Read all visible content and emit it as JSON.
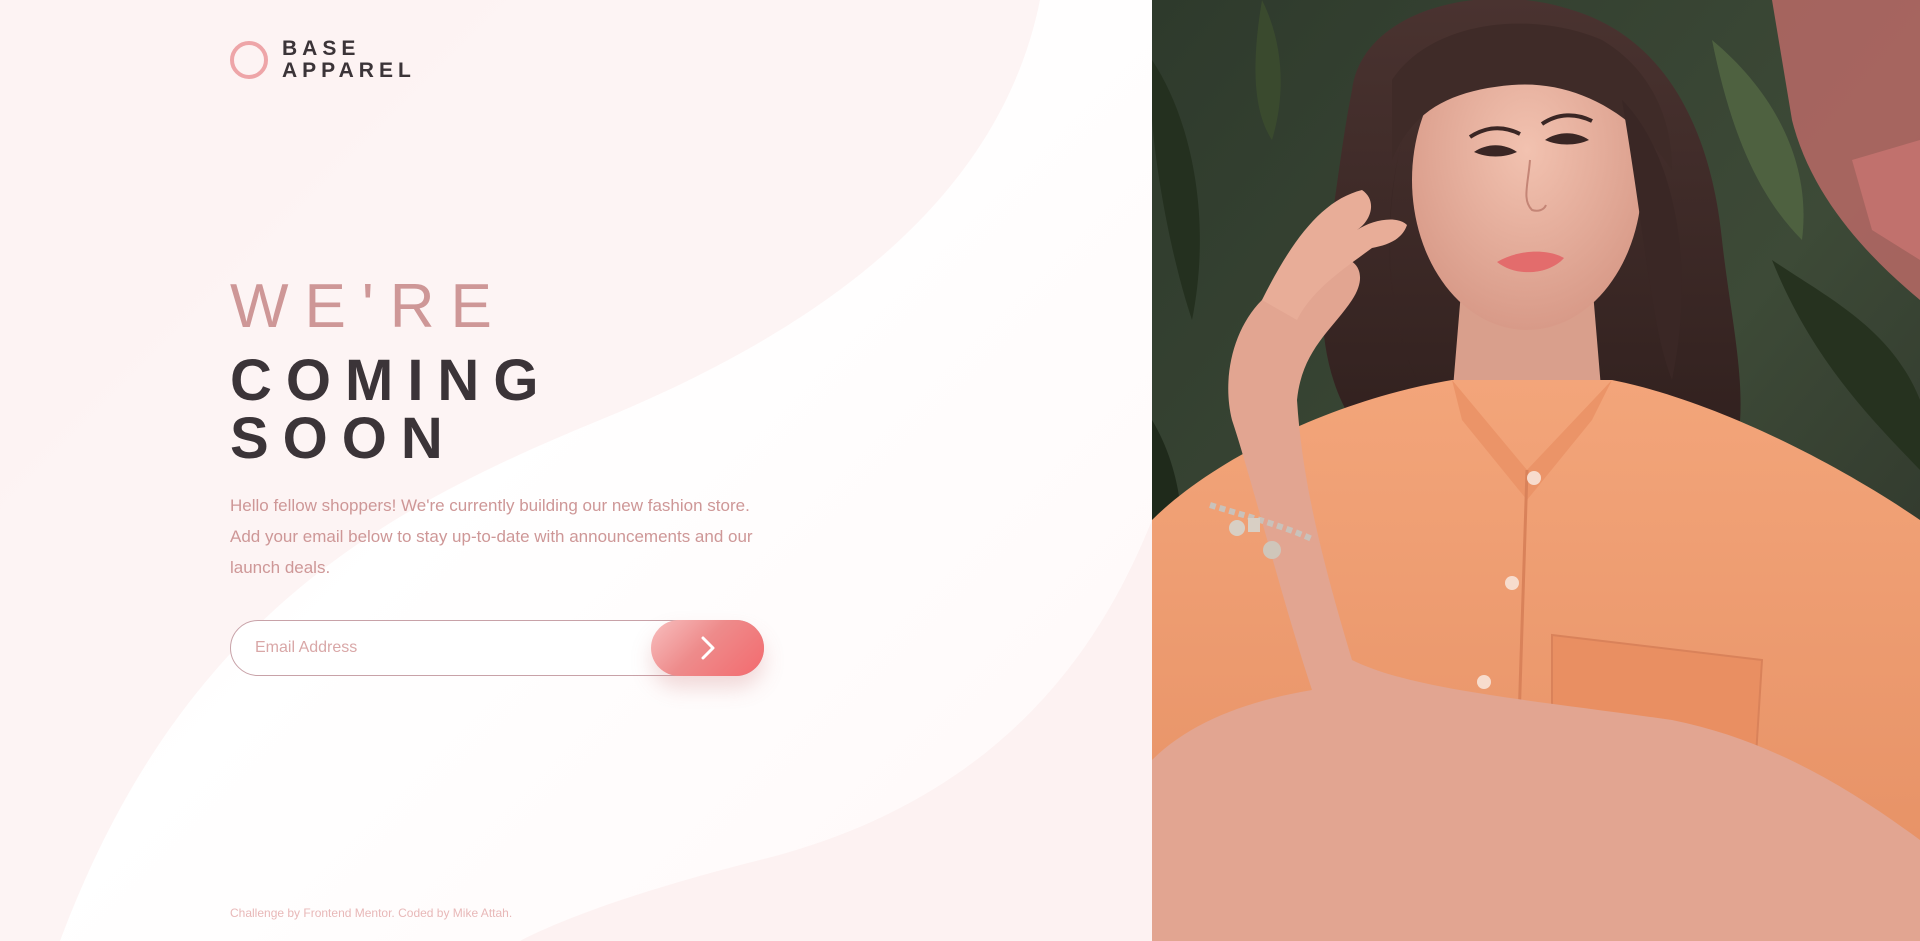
{
  "logo": {
    "line1": "BASE",
    "line2": "APPAREL",
    "icon": "ring-icon"
  },
  "headline": {
    "light": "WE'RE",
    "dark_line1": "COMING",
    "dark_line2": "SOON"
  },
  "description": "Hello fellow shoppers! We're currently building our new fashion store. Add your email below to stay up-to-date with announcements and our launch deals.",
  "form": {
    "email_placeholder": "Email Address",
    "submit_icon": "chevron-right-icon"
  },
  "footer": "Challenge by Frontend Mentor. Coded by Mike Attah.",
  "hero_image": {
    "description": "Portrait photo of a woman with wavy brown hair wearing an orange shirt and a charm bracelet, in front of green foliage"
  },
  "colors": {
    "accent": "#ce9797",
    "dark_text": "#3b3438",
    "button_start": "#f8bfbf",
    "button_end": "#f36a6e",
    "logo_ring": "#eea5a8"
  }
}
